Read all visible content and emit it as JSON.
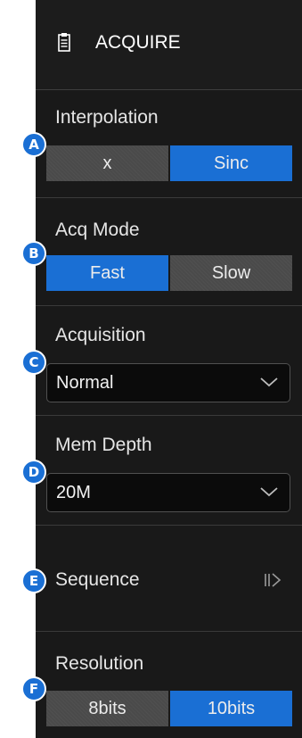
{
  "header": {
    "title": "ACQUIRE",
    "icon": "clipboard-icon"
  },
  "interpolation": {
    "label": "Interpolation",
    "options": [
      "x",
      "Sinc"
    ],
    "selected": "Sinc"
  },
  "acq_mode": {
    "label": "Acq Mode",
    "options": [
      "Fast",
      "Slow"
    ],
    "selected": "Fast"
  },
  "acquisition": {
    "label": "Acquisition",
    "value": "Normal"
  },
  "mem_depth": {
    "label": "Mem Depth",
    "value": "20M"
  },
  "sequence": {
    "label": "Sequence",
    "icon": "play-pause-icon"
  },
  "resolution": {
    "label": "Resolution",
    "options": [
      "8bits",
      "10bits"
    ],
    "selected": "10bits"
  },
  "badges": [
    "A",
    "B",
    "C",
    "D",
    "E",
    "F"
  ],
  "colors": {
    "accent": "#1a6fd4",
    "panel": "#1a1a1a",
    "off_button": "#4a4a4a"
  }
}
